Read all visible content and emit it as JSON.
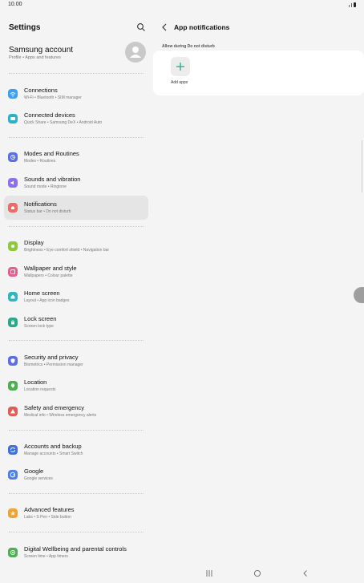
{
  "status": {
    "time": "10.00"
  },
  "left": {
    "title": "Settings",
    "account": {
      "name": "Samsung account",
      "sub": "Profile  •  Apps and features"
    },
    "items": [
      {
        "title": "Connections",
        "sub": "Wi-Fi  •  Bluetooth  •  SIM manager",
        "icon": "wifi-icon",
        "color": "#3b9ff3"
      },
      {
        "title": "Connected devices",
        "sub": "Quick Share  •  Samsung DeX  •  Android Auto",
        "icon": "devices-icon",
        "color": "#2ab2c9"
      },
      {
        "title": "Modes and Routines",
        "sub": "Modes  •  Routines",
        "icon": "modes-icon",
        "color": "#5a6ee8"
      },
      {
        "title": "Sounds and vibration",
        "sub": "Sound mode  •  Ringtone",
        "icon": "speaker-icon",
        "color": "#8e6ff0"
      },
      {
        "title": "Notifications",
        "sub": "Status bar  •  Do not disturb",
        "icon": "bell-icon",
        "color": "#ee6a64"
      },
      {
        "title": "Display",
        "sub": "Brightness  •  Eye comfort shield  •  Navigation bar",
        "icon": "sun-icon",
        "color": "#8ec93a"
      },
      {
        "title": "Wallpaper and style",
        "sub": "Wallpapers  •  Colour palette",
        "icon": "wallpaper-icon",
        "color": "#e65d8f"
      },
      {
        "title": "Home screen",
        "sub": "Layout  •  App icon badges",
        "icon": "home-icon",
        "color": "#2bb6c2"
      },
      {
        "title": "Lock screen",
        "sub": "Screen lock type",
        "icon": "lock-icon",
        "color": "#2aa88a"
      },
      {
        "title": "Security and privacy",
        "sub": "Biometrics  •  Permission manager",
        "icon": "shield-icon",
        "color": "#5a6ee8"
      },
      {
        "title": "Location",
        "sub": "Location requests",
        "icon": "location-icon",
        "color": "#4caf50"
      },
      {
        "title": "Safety and emergency",
        "sub": "Medical info  •  Wireless emergency alerts",
        "icon": "emergency-icon",
        "color": "#e35b57"
      },
      {
        "title": "Accounts and backup",
        "sub": "Manage accounts  •  Smart Switch",
        "icon": "sync-icon",
        "color": "#3f6fe0"
      },
      {
        "title": "Google",
        "sub": "Google services",
        "icon": "google-icon",
        "color": "#4a7ef0"
      },
      {
        "title": "Advanced features",
        "sub": "Labs  •  S Pen  •  Side button",
        "icon": "star-icon",
        "color": "#f1a232"
      },
      {
        "title": "Digital Wellbeing and parental controls",
        "sub": "Screen time  •  App timers",
        "icon": "wellbeing-icon",
        "color": "#4caf50"
      }
    ]
  },
  "right": {
    "title": "App notifications",
    "allow_label": "Allow during Do not disturb",
    "add_label": "Add apps"
  }
}
